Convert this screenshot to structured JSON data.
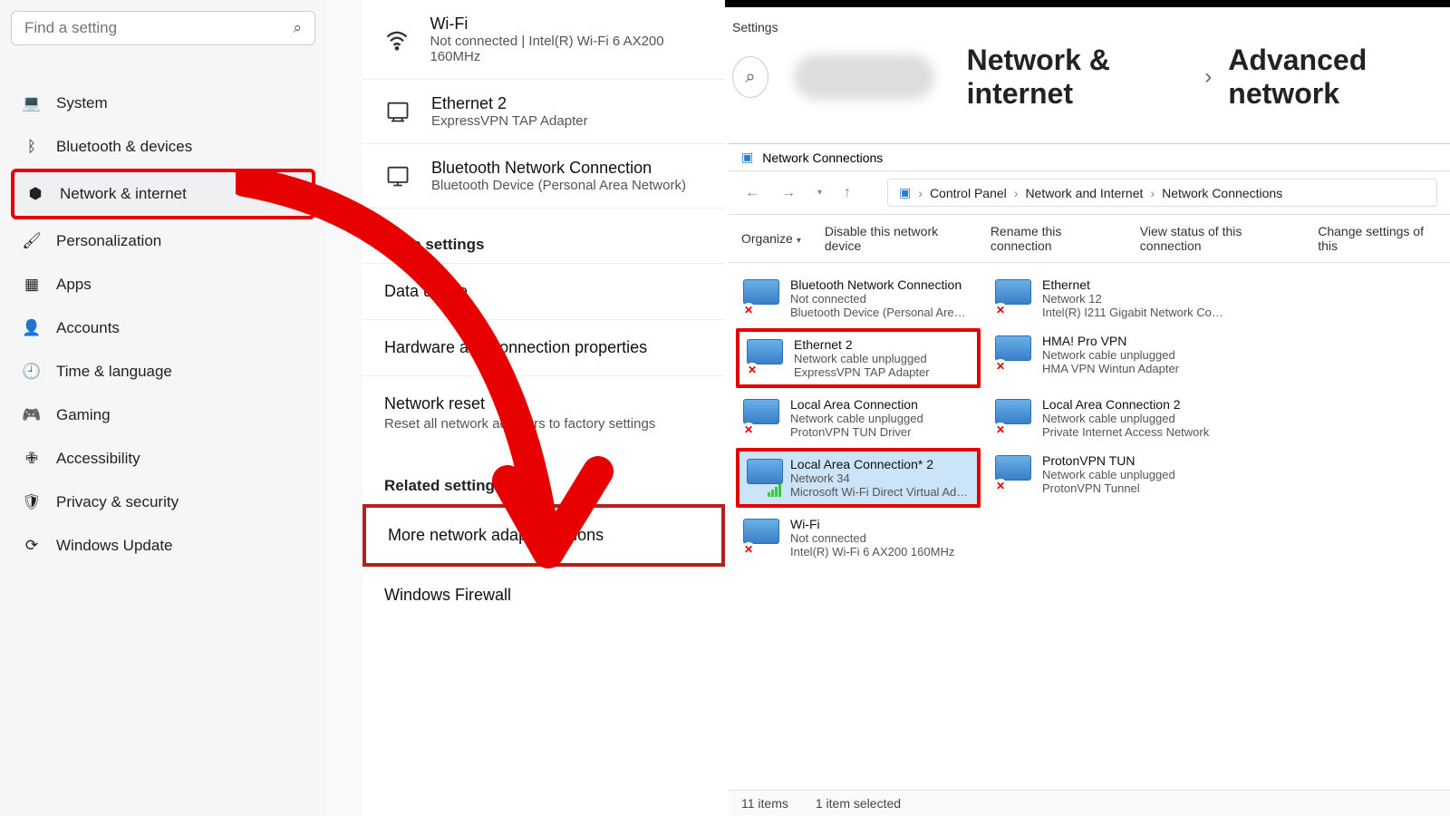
{
  "search": {
    "placeholder": "Find a setting"
  },
  "nav": [
    {
      "label": "System",
      "icon": "💻"
    },
    {
      "label": "Bluetooth & devices",
      "icon": "ᛒ"
    },
    {
      "label": "Network & internet",
      "icon": "⬢",
      "selected": true
    },
    {
      "label": "Personalization",
      "icon": "🖌"
    },
    {
      "label": "Apps",
      "icon": "▦"
    },
    {
      "label": "Accounts",
      "icon": "👤"
    },
    {
      "label": "Time & language",
      "icon": "🕘"
    },
    {
      "label": "Gaming",
      "icon": "🎮"
    },
    {
      "label": "Accessibility",
      "icon": "✙"
    },
    {
      "label": "Privacy & security",
      "icon": "🛡"
    },
    {
      "label": "Windows Update",
      "icon": "⟳"
    }
  ],
  "networks": [
    {
      "title": "Wi-Fi",
      "sub": "Not connected | Intel(R) Wi-Fi 6 AX200 160MHz",
      "icon": "wifi"
    },
    {
      "title": "Ethernet 2",
      "sub": "ExpressVPN TAP Adapter",
      "icon": "eth"
    },
    {
      "title": "Bluetooth Network Connection",
      "sub": "Bluetooth Device (Personal Area Network)",
      "icon": "bt"
    }
  ],
  "more_head": "More settings",
  "more": [
    {
      "title": "Data usage"
    },
    {
      "title": "Hardware and connection properties"
    },
    {
      "title": "Network reset",
      "sub": "Reset all network adapters to factory settings"
    }
  ],
  "related_head": "Related settings",
  "related": [
    {
      "title": "More network adapter options",
      "hl": true
    },
    {
      "title": "Windows Firewall"
    }
  ],
  "right": {
    "app": "Settings",
    "bc1": "Network & internet",
    "bc2": "Advanced network"
  },
  "nc": {
    "wintitle": "Network Connections",
    "path": [
      "Control Panel",
      "Network and Internet",
      "Network Connections"
    ],
    "toolbar": [
      "Organize",
      "Disable this network device",
      "Rename this connection",
      "View status of this connection",
      "Change settings of this"
    ],
    "adapters": [
      {
        "n": "Bluetooth Network Connection",
        "s": "Not connected",
        "d": "Bluetooth Device (Personal Area ...",
        "x": true
      },
      {
        "n": "Ethernet",
        "s": "Network 12",
        "d": "Intel(R) I211 Gigabit Network Con...",
        "x": true
      },
      {
        "n": "Ethernet 2",
        "s": "Network cable unplugged",
        "d": "ExpressVPN TAP Adapter",
        "x": true,
        "hl": true
      },
      {
        "n": "HMA! Pro VPN",
        "s": "Network cable unplugged",
        "d": "HMA VPN Wintun Adapter",
        "x": true
      },
      {
        "n": "Local Area Connection",
        "s": "Network cable unplugged",
        "d": "ProtonVPN TUN Driver",
        "x": true
      },
      {
        "n": "Local Area Connection 2",
        "s": "Network cable unplugged",
        "d": "Private Internet Access Network",
        "x": true
      },
      {
        "n": "Local Area Connection* 2",
        "s": "Network 34",
        "d": "Microsoft Wi-Fi Direct Virtual Ada...",
        "x": false,
        "sel": true
      },
      {
        "n": "ProtonVPN TUN",
        "s": "Network cable unplugged",
        "d": "ProtonVPN Tunnel",
        "x": true
      },
      {
        "n": "Wi-Fi",
        "s": "Not connected",
        "d": "Intel(R) Wi-Fi 6 AX200 160MHz",
        "x": true
      }
    ],
    "status1": "11 items",
    "status2": "1 item selected"
  }
}
